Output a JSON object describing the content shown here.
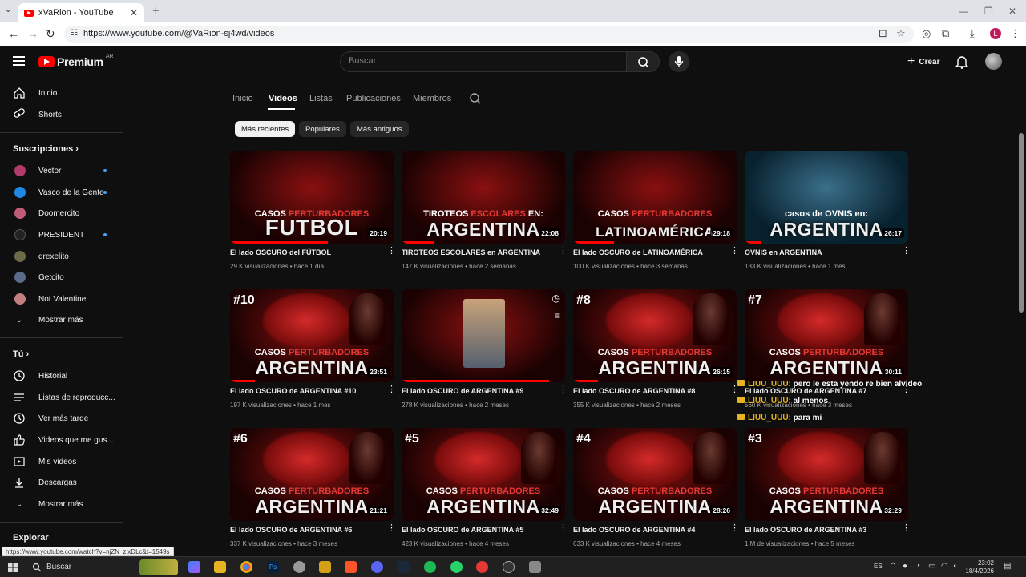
{
  "browser": {
    "tab_title": "xVaRion - YouTube",
    "url": "https://www.youtube.com/@VaRion-sj4wd/videos",
    "status_url": "https://www.youtube.com/watch?v=njZN_zlxDLc&t=1549s",
    "profile_initial": "L"
  },
  "header": {
    "logo": "Premium",
    "region": "AR",
    "search_placeholder": "Buscar",
    "create_label": "Crear"
  },
  "sidebar": {
    "top": [
      {
        "label": "Inicio"
      },
      {
        "label": "Shorts"
      }
    ],
    "subscriptions_title": "Suscripciones",
    "subscriptions": [
      {
        "label": "Vector",
        "live": true,
        "color": "#b23a6a"
      },
      {
        "label": "Vasco de la Gente",
        "live": true,
        "color": "#1e88e5"
      },
      {
        "label": "Doomercito",
        "live": false,
        "color": "#c25a7a"
      },
      {
        "label": "PRESIDENT",
        "live": true,
        "color": "#222222"
      },
      {
        "label": "drexelito",
        "live": false,
        "color": "#6b6b4a"
      },
      {
        "label": "Getcito",
        "live": false,
        "color": "#5a6a8a"
      },
      {
        "label": "Not Valentine",
        "live": false,
        "color": "#c08080"
      }
    ],
    "show_more": "Mostrar más",
    "you_title": "Tú",
    "you_items": [
      {
        "label": "Historial"
      },
      {
        "label": "Listas de reproducc..."
      },
      {
        "label": "Ver más tarde"
      },
      {
        "label": "Videos que me gus..."
      },
      {
        "label": "Mis videos"
      },
      {
        "label": "Descargas"
      }
    ],
    "show_more_2": "Mostrar más",
    "explore_title": "Explorar"
  },
  "channel_tabs": [
    "Inicio",
    "Videos",
    "Listas",
    "Publicaciones",
    "Miembros"
  ],
  "active_tab": "Videos",
  "chips": [
    "Más recientes",
    "Populares",
    "Más antiguos"
  ],
  "videos": [
    {
      "title": "El lado OSCURO del FÚTBOL",
      "meta": "29 K visualizaciones • hace 1 día",
      "duration": "20:19",
      "small": [
        "CASOS ",
        "PERTURBADORES"
      ],
      "big": "FUTBOL",
      "num": "",
      "progress": 0.6
    },
    {
      "title": "TIROTEOS ESCOLARES en ARGENTINA",
      "meta": "147 K visualizaciones • hace 2 semanas",
      "duration": "22:08",
      "small": [
        "TIROTEOS ",
        "ESCOLARES",
        " EN:"
      ],
      "big": "ARGENTINA",
      "num": "",
      "progress": 0.2
    },
    {
      "title": "El lado OSCURO de LATINOAMÉRICA",
      "meta": "100 K visualizaciones • hace 3 semanas",
      "duration": "29:18",
      "small": [
        "CASOS ",
        "PERTURBADORES"
      ],
      "big": "LATINOAMÉRICA",
      "num": "",
      "progress": 0.25
    },
    {
      "title": "OVNIS en ARGENTINA",
      "meta": "133 K visualizaciones • hace 1 mes",
      "duration": "26:17",
      "small": [
        "casos de OVNIS en:",
        ""
      ],
      "big": "ARGENTINA",
      "num": "",
      "progress": 0.1
    },
    {
      "title": "El lado OSCURO de ARGENTINA #10",
      "meta": "197 K visualizaciones • hace 1 mes",
      "duration": "23:51",
      "small": [
        "CASOS ",
        "PERTURBADORES"
      ],
      "big": "ARGENTINA",
      "num": "#10",
      "progress": 0.15
    },
    {
      "title": "El lado OSCURO de ARGENTINA #9",
      "meta": "278 K visualizaciones • hace 2 meses",
      "duration": "",
      "small": [
        "",
        ""
      ],
      "big": "",
      "num": "",
      "progress": 0.9
    },
    {
      "title": "El lado OSCURO de ARGENTINA #8",
      "meta": "355 K visualizaciones • hace 2 meses",
      "duration": "26:15",
      "small": [
        "CASOS ",
        "PERTURBADORES"
      ],
      "big": "ARGENTINA",
      "num": "#8",
      "progress": 0.15
    },
    {
      "title": "El lado OSCURO de ARGENTINA #7",
      "meta": "560 K visualizaciones • hace 3 meses",
      "duration": "30:11",
      "small": [
        "CASOS ",
        "PERTURBADORES"
      ],
      "big": "ARGENTINA",
      "num": "#7",
      "progress": 0.0
    },
    {
      "title": "El lado OSCURO de ARGENTINA #6",
      "meta": "337 K visualizaciones • hace 3 meses",
      "duration": "21:21",
      "small": [
        "CASOS ",
        "PERTURBADORES"
      ],
      "big": "ARGENTINA",
      "num": "#6",
      "progress": 0.0
    },
    {
      "title": "El lado OSCURO de ARGENTINA #5",
      "meta": "423 K visualizaciones • hace 4 meses",
      "duration": "32:49",
      "small": [
        "CASOS ",
        "PERTURBADORES"
      ],
      "big": "ARGENTINA",
      "num": "#5",
      "progress": 0.0
    },
    {
      "title": "El lado OSCURO de ARGENTINA #4",
      "meta": "633 K visualizaciones • hace 4 meses",
      "duration": "28:26",
      "small": [
        "CASOS ",
        "PERTURBADORES"
      ],
      "big": "ARGENTINA",
      "num": "#4",
      "progress": 0.0
    },
    {
      "title": "El lado OSCURO de ARGENTINA #3",
      "meta": "1 M de visualizaciones • hace 5 meses",
      "duration": "32:29",
      "small": [
        "CASOS ",
        "PERTURBADORES"
      ],
      "big": "ARGENTINA",
      "num": "#3",
      "progress": 0.0
    }
  ],
  "chat": [
    {
      "user": "LIUU_UUU",
      "text": ": pero le esta yendo re bien alvideo"
    },
    {
      "user": "LIUU_UUU",
      "text": ": al menos"
    },
    {
      "user": "LIUU_UUU",
      "text": ": para mi"
    }
  ],
  "taskbar": {
    "search_label": "Buscar",
    "lang": "ES",
    "time": "23:02",
    "date": "18/4/2026"
  },
  "colors": {
    "accent": "#ff0000",
    "chat_user": "#e6b422",
    "live_dot": "#3ea6ff"
  }
}
